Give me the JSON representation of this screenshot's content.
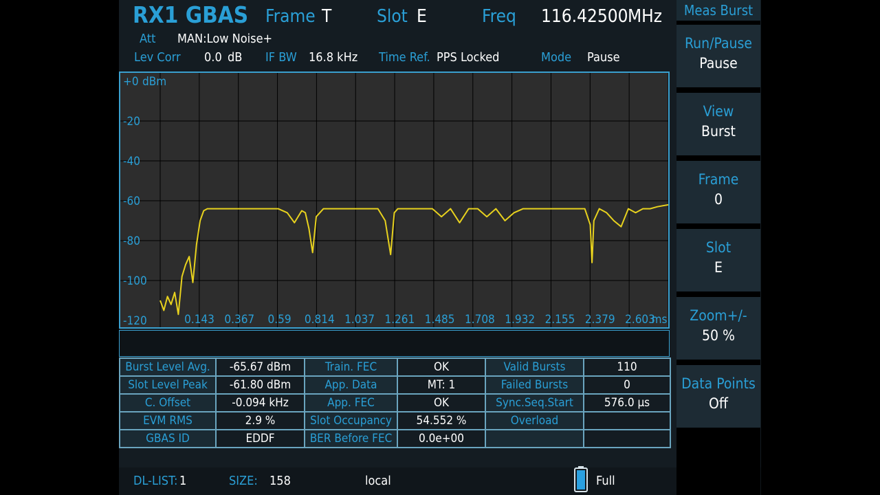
{
  "header": {
    "app_title": "RX1 GBAS",
    "frame_label": "Frame",
    "frame_value": "T",
    "slot_label": "Slot",
    "slot_value": "E",
    "freq_label": "Freq",
    "freq_value": "116.42500",
    "freq_unit": "MHz",
    "att_label": "Att",
    "att_value": "MAN:Low Noise+",
    "lev_corr_label": "Lev Corr",
    "lev_corr_value": "0.0",
    "lev_corr_unit": "dB",
    "if_bw_label": "IF BW",
    "if_bw_value": "16.8 kHz",
    "time_ref_label": "Time Ref.",
    "time_ref_value": "PPS Locked",
    "mode_label": "Mode",
    "mode_value": "Pause"
  },
  "chart_data": {
    "type": "line",
    "ylabel": "dBm",
    "xlabel": "ms",
    "y_ticks": [
      "+0",
      "-20",
      "-40",
      "-60",
      "-80",
      "-100",
      "-120"
    ],
    "x_ticks": [
      "0.143",
      "0.367",
      "0.59",
      "0.814",
      "1.037",
      "1.261",
      "1.485",
      "1.708",
      "1.932",
      "2.155",
      "2.379",
      "2.603"
    ],
    "ylim": [
      -120,
      0
    ],
    "xlim": [
      0,
      2.8
    ],
    "grid": true,
    "series": [
      {
        "color": "#e8d21e",
        "x": [
          0.0,
          0.02,
          0.04,
          0.06,
          0.08,
          0.1,
          0.12,
          0.14,
          0.16,
          0.18,
          0.2,
          0.22,
          0.24,
          0.26,
          0.28,
          0.3,
          0.35,
          0.45,
          0.55,
          0.65,
          0.7,
          0.74,
          0.78,
          0.8,
          0.82,
          0.84,
          0.86,
          0.9,
          1.0,
          1.1,
          1.2,
          1.24,
          1.27,
          1.29,
          1.31,
          1.34,
          1.4,
          1.5,
          1.55,
          1.6,
          1.65,
          1.7,
          1.75,
          1.8,
          1.85,
          1.9,
          1.95,
          2.0,
          2.05,
          2.1,
          2.15,
          2.2,
          2.25,
          2.3,
          2.34,
          2.37,
          2.38,
          2.39,
          2.42,
          2.46,
          2.5,
          2.54,
          2.58,
          2.62,
          2.66,
          2.7,
          2.74,
          2.8
        ],
        "y": [
          -110,
          -115,
          -108,
          -112,
          -106,
          -117,
          -98,
          -92,
          -88,
          -101,
          -82,
          -70,
          -65,
          -64,
          -64,
          -64,
          -64,
          -64,
          -64,
          -64,
          -66,
          -71,
          -65,
          -66,
          -74,
          -86,
          -68,
          -64,
          -64,
          -64,
          -64,
          -70,
          -87,
          -66,
          -64,
          -64,
          -64,
          -64,
          -68,
          -64,
          -71,
          -64,
          -64,
          -68,
          -64,
          -70,
          -66,
          -64,
          -64,
          -64,
          -64,
          -64,
          -64,
          -64,
          -64,
          -72,
          -91,
          -70,
          -64,
          -66,
          -70,
          -73,
          -64,
          -66,
          -64,
          -64,
          -63,
          -62
        ]
      }
    ]
  },
  "results": {
    "rows": [
      [
        "Burst Level Avg.",
        "-65.67 dBm",
        "Train. FEC",
        "OK",
        "Valid Bursts",
        "110"
      ],
      [
        "Slot Level Peak",
        "-61.80 dBm",
        "App. Data",
        "MT: 1",
        "Failed Bursts",
        "0"
      ],
      [
        "C. Offset",
        "-0.094 kHz",
        "App. FEC",
        "OK",
        "Sync.Seq.Start",
        "576.0 µs"
      ],
      [
        "EVM RMS",
        "2.9 %",
        "Slot Occupancy",
        "54.552 %",
        "Overload",
        ""
      ],
      [
        "GBAS ID",
        "EDDF",
        "BER Before FEC",
        "0.0e+00",
        "",
        ""
      ]
    ]
  },
  "footer": {
    "dl_list_label": "DL-LIST:",
    "dl_list_value": "1",
    "size_label": "SIZE:",
    "size_value": "158",
    "location": "local",
    "battery_status": "Full"
  },
  "softkeys": {
    "header": "Meas Burst",
    "items": [
      {
        "title": "Run/Pause",
        "value": "Pause"
      },
      {
        "title": "View",
        "value": "Burst"
      },
      {
        "title": "Frame",
        "value": "0"
      },
      {
        "title": "Slot",
        "value": "E"
      },
      {
        "title": "Zoom+/-",
        "value": "50 %"
      },
      {
        "title": "Data Points",
        "value": "Off"
      }
    ]
  },
  "colors": {
    "accent": "#2a9fd6",
    "trace": "#e8d21e",
    "battery": "#2aa0e0"
  }
}
